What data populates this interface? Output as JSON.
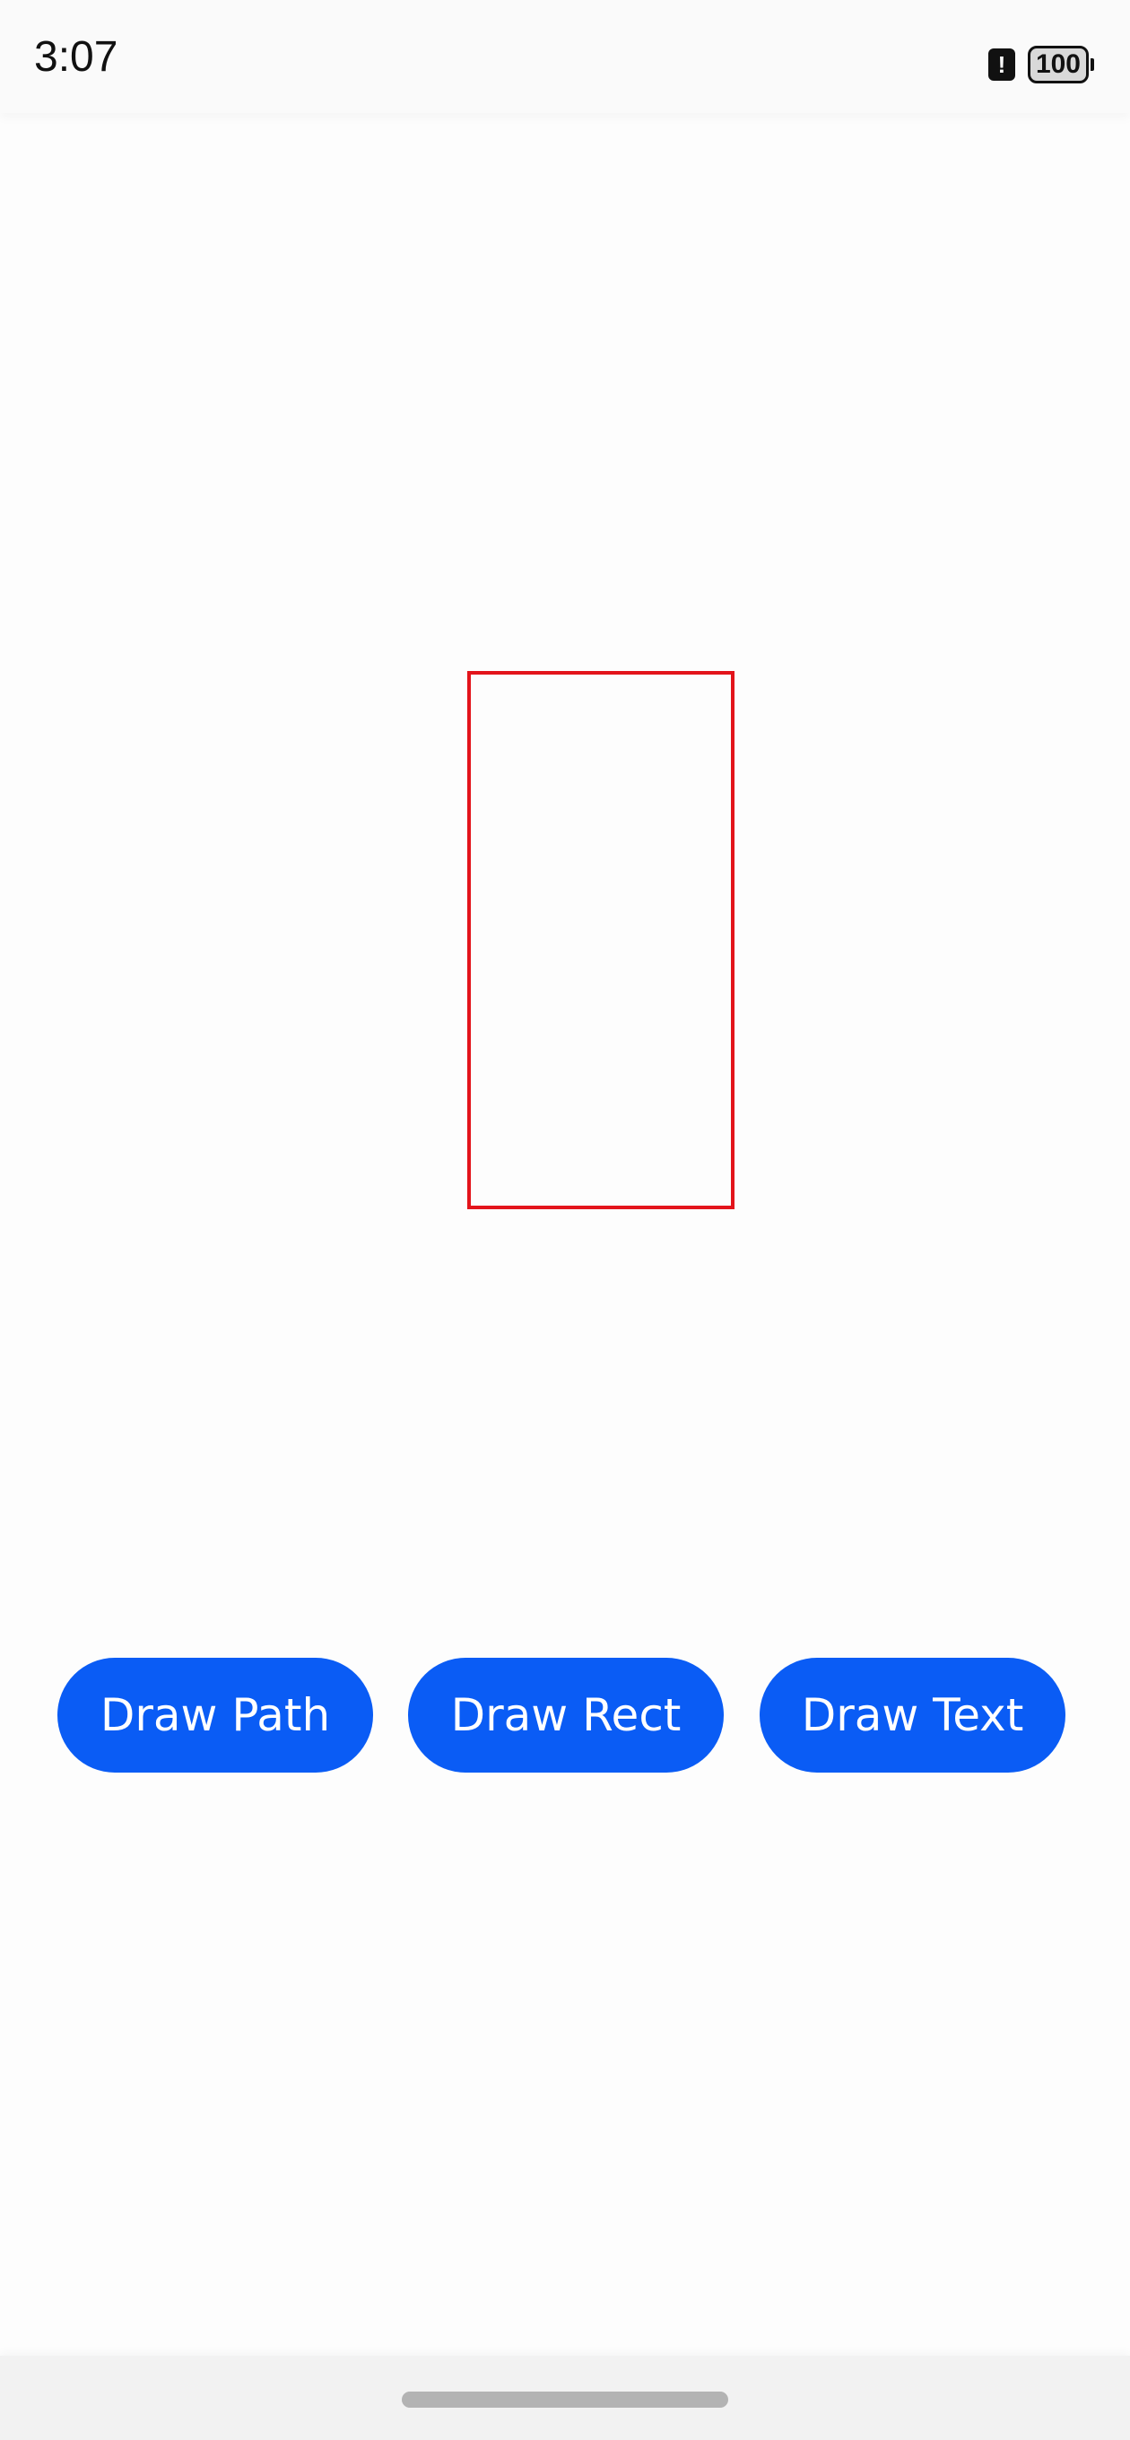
{
  "status_bar": {
    "time": "3:07",
    "alert_icon": "!",
    "battery": "100"
  },
  "canvas": {
    "shape": "rectangle",
    "stroke_color": "#e3141b"
  },
  "buttons": {
    "draw_path": "Draw Path",
    "draw_rect": "Draw Rect",
    "draw_text": "Draw Text"
  },
  "theme": {
    "accent": "#0a5cf5"
  }
}
